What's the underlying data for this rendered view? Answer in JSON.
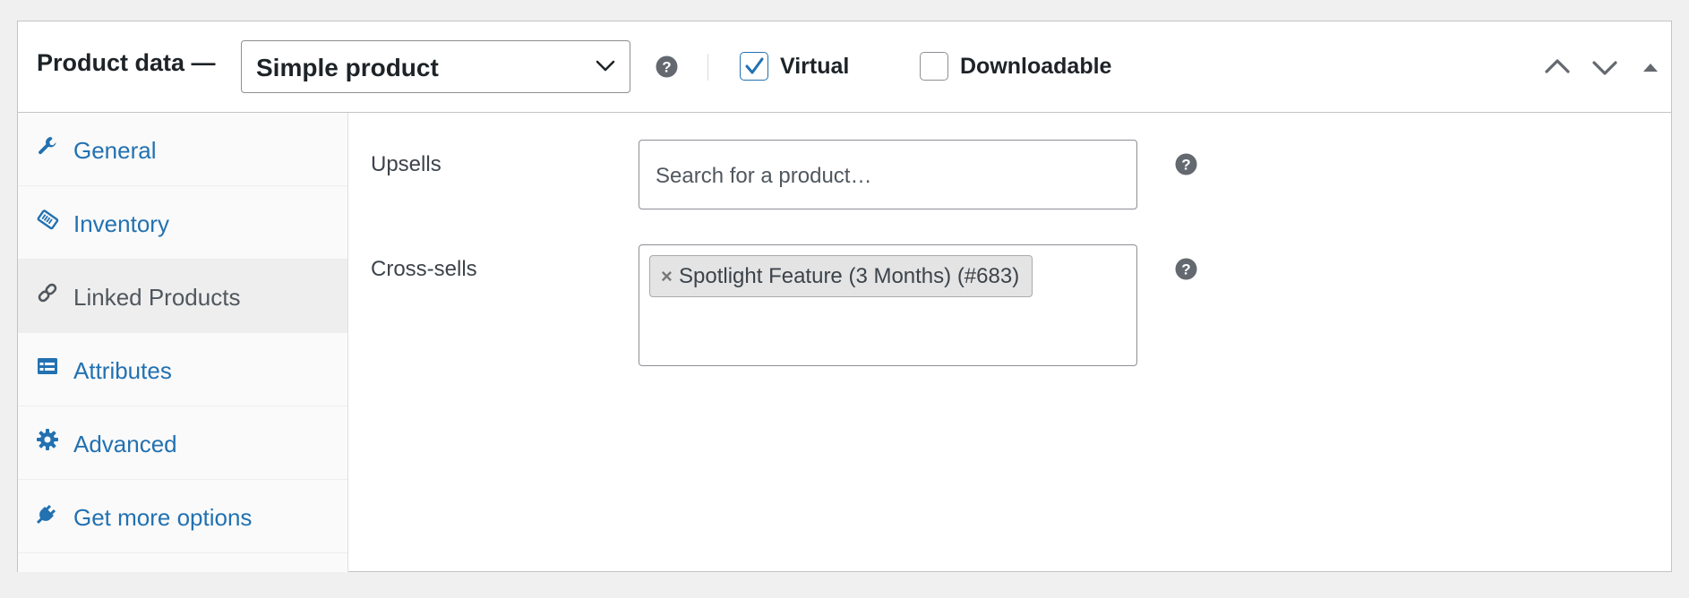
{
  "header": {
    "title": "Product data —",
    "product_type": "Simple product",
    "virtual_label": "Virtual",
    "virtual_checked": true,
    "downloadable_label": "Downloadable",
    "downloadable_checked": false
  },
  "tabs": [
    {
      "label": "General",
      "icon": "wrench-icon"
    },
    {
      "label": "Inventory",
      "icon": "tag-icon"
    },
    {
      "label": "Linked Products",
      "icon": "link-icon",
      "active": true
    },
    {
      "label": "Attributes",
      "icon": "list-card-icon"
    },
    {
      "label": "Advanced",
      "icon": "gear-icon"
    },
    {
      "label": "Get more options",
      "icon": "plug-icon"
    }
  ],
  "fields": {
    "upsells": {
      "label": "Upsells",
      "placeholder": "Search for a product…"
    },
    "cross_sells": {
      "label": "Cross-sells",
      "chips": [
        "Spotlight Feature (3 Months) (#683)"
      ],
      "chip_remove": "×"
    }
  },
  "colors": {
    "link": "#2271b1",
    "active_tab_bg": "#eeeeee",
    "border": "#c3c4c7"
  }
}
